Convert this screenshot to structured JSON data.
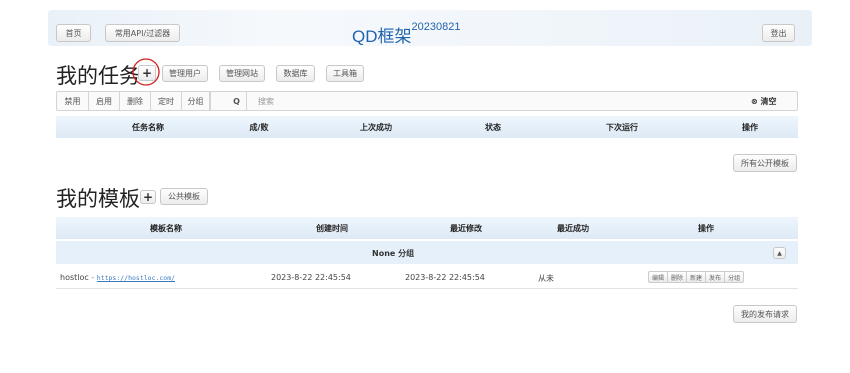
{
  "topnav": {
    "home": "首页",
    "api_filter": "常用API/过滤器",
    "brand": "QD框架",
    "version": "20230821",
    "logout": "登出"
  },
  "tasks": {
    "title": "我的任务",
    "add_label": "+",
    "buttons": {
      "manage_users": "管理用户",
      "manage_site": "管理网站",
      "database": "数据库",
      "toolbox": "工具箱"
    },
    "toolbar": {
      "disable": "禁用",
      "enable": "启用",
      "delete": "删除",
      "schedule": "定时",
      "group": "分组",
      "search_icon": "Q",
      "search_placeholder": "搜索",
      "clear_icon": "⊗",
      "clear": "清空"
    },
    "columns": [
      "任务名称",
      "成/败",
      "上次成功",
      "状态",
      "下次运行",
      "操作"
    ]
  },
  "public_templates_button": "所有公开模板",
  "templates": {
    "title": "我的模板",
    "add_label": "+",
    "public_button": "公共模板",
    "columns": [
      "模板名称",
      "创建时间",
      "最近修改",
      "最近成功",
      "操作"
    ],
    "group_label": "None 分组",
    "collapse_icon": "▲",
    "rows": [
      {
        "name": "hostloc",
        "sep": "-",
        "url": "https://hostloc.com/",
        "created": "2023-8-22 22:45:54",
        "modified": "2023-8-22 22:45:54",
        "last_success": "从未",
        "actions": [
          "编辑",
          "删除",
          "新建",
          "发布",
          "分组"
        ]
      }
    ]
  },
  "my_publish_requests": "我的发布请求"
}
